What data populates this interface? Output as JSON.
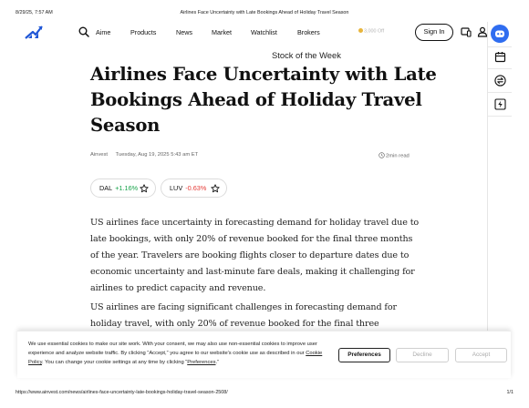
{
  "print_header": {
    "datetime": "8/29/25, 7:57 AM",
    "doc_title": "Airlines Face Uncertainty with Late Bookings Ahead of Holiday Travel Season"
  },
  "nav": {
    "aime": "Aime",
    "products": "Products",
    "news": "News",
    "market": "Market",
    "watchlist": "Watchlist",
    "brokers": "Brokers",
    "coins": "3,000 Off",
    "signin": "Sign In",
    "icons": [
      "logo-icon",
      "search-icon",
      "coin-icon",
      "device-icon",
      "user-icon"
    ]
  },
  "right_rail": {
    "icons": [
      "ai-assistant-icon",
      "calendar-icon",
      "swap-icon",
      "lightning-icon"
    ]
  },
  "stock_of_week": "Stock of the Week",
  "article": {
    "title": "Airlines Face Uncertainty with Late Bookings Ahead of Holiday Travel Season",
    "source": "Ainvest",
    "date": "Tuesday, Aug 19, 2025 5:43 am ET",
    "read_time": "2min read",
    "tickers": [
      {
        "symbol": "DAL",
        "change": "+1.16%",
        "direction": "up"
      },
      {
        "symbol": "LUV",
        "change": "-0.63%",
        "direction": "down"
      }
    ],
    "paragraphs": [
      "US airlines face uncertainty in forecasting demand for holiday travel due to late bookings, with only 20% of revenue booked for the final three months of the year. Travelers are booking flights closer to departure dates due to economic uncertainty and last-minute fare deals, making it challenging for airlines to predict capacity and revenue.",
      "US airlines are facing significant challenges in forecasting demand for holiday travel, with only 20% of revenue booked for the final three"
    ]
  },
  "cookie_banner": {
    "text_part1": "We use essential cookies to make our site work. With your consent, we may also use non-essential cookies to improve user experience and analyze website traffic. By clicking “Accept,” you agree to our website's cookie use as described in our ",
    "cookie_policy_link": "Cookie Policy",
    "text_part2": ". You can change your cookie settings at any time by clicking “",
    "preferences_link": "Preferences",
    "text_part3": ".”",
    "preferences_button": "Preferences",
    "decline_button": "Decline",
    "accept_button": "Accept"
  },
  "print_footer": {
    "url": "https://www.ainvest.com/news/airlines-face-uncertainty-late-bookings-holiday-travel-season-2508/",
    "page": "1/1"
  },
  "colors": {
    "positive": "#17a34a",
    "negative": "#e53935",
    "logo_blue": "#1f56d6",
    "ai_badge": "#2f6df0"
  }
}
